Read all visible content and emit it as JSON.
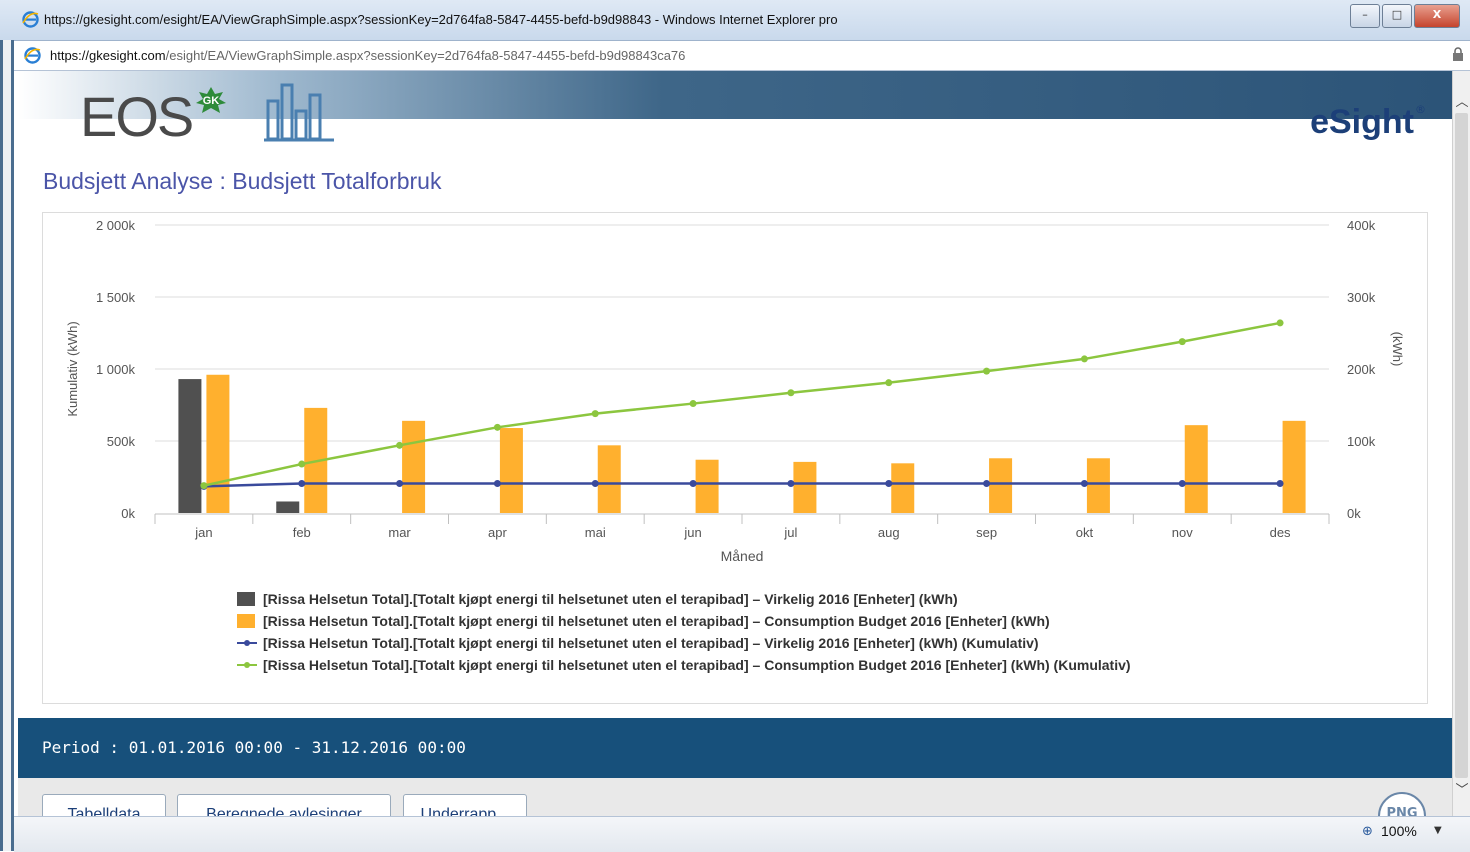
{
  "window": {
    "title": "https://gkesight.com/esight/EA/ViewGraphSimple.aspx?sessionKey=2d764fa8-5847-4455-befd-b9d98843 - Windows Internet Explorer pro",
    "minimize_label": "–",
    "maximize_label": "□",
    "close_label": "X"
  },
  "address": {
    "host": "https://gkesight.com",
    "path": "/esight/EA/ViewGraphSimple.aspx?sessionKey=2d764fa8-5847-4455-befd-b9d98843ca76"
  },
  "brand": {
    "logo_text": "EOS",
    "badge_text": "GK",
    "product_name": "eSight",
    "registered": "®"
  },
  "page_title": "Budsjett Analyse : Budsjett Totalforbruk",
  "chart_data": {
    "type": "bar",
    "xlabel": "Måned",
    "ylabel_left": "Kumulativ (kWh)",
    "ylabel_right": "(kWh)",
    "categories": [
      "jan",
      "feb",
      "mar",
      "apr",
      "mai",
      "jun",
      "jul",
      "aug",
      "sep",
      "okt",
      "nov",
      "des"
    ],
    "y_left_lim": [
      0,
      2000000
    ],
    "y_right_lim": [
      0,
      400000
    ],
    "y_left_ticks": [
      {
        "value": 0,
        "label": "0k"
      },
      {
        "value": 500000,
        "label": "500k"
      },
      {
        "value": 1000000,
        "label": "1 000k"
      },
      {
        "value": 1500000,
        "label": "1 500k"
      },
      {
        "value": 2000000,
        "label": "2 000k"
      }
    ],
    "y_right_ticks": [
      {
        "value": 0,
        "label": "0k"
      },
      {
        "value": 100000,
        "label": "100k"
      },
      {
        "value": 200000,
        "label": "200k"
      },
      {
        "value": 300000,
        "label": "300k"
      },
      {
        "value": 400000,
        "label": "400k"
      }
    ],
    "grid": true,
    "legend_position": "bottom",
    "series": [
      {
        "name": "[Rissa Helsetun Total].[Totalt kjøpt energi til helsetunet uten el terapibad] – Virkelig 2016 [Enheter] (kWh)",
        "kind": "bar",
        "axis": "left",
        "color": "#505050",
        "values": [
          930000,
          80000,
          null,
          null,
          null,
          null,
          null,
          null,
          null,
          null,
          null,
          null
        ]
      },
      {
        "name": "[Rissa Helsetun Total].[Totalt kjøpt energi til helsetunet uten el terapibad] – Consumption Budget 2016 [Enheter] (kWh)",
        "kind": "bar",
        "axis": "left",
        "color": "#ffb02e",
        "values": [
          960000,
          730000,
          640000,
          590000,
          470000,
          370000,
          355000,
          345000,
          380000,
          380000,
          610000,
          640000
        ]
      },
      {
        "name": "[Rissa Helsetun Total].[Totalt kjøpt energi til helsetunet uten el terapibad] – Virkelig 2016 [Enheter] (kWh) (Kumulativ)",
        "kind": "line",
        "axis": "right",
        "color": "#3a4a9c",
        "values": [
          37000,
          41000,
          41000,
          41000,
          41000,
          41000,
          41000,
          41000,
          41000,
          41000,
          41000,
          41000
        ]
      },
      {
        "name": "[Rissa Helsetun Total].[Totalt kjøpt energi til helsetunet uten el terapibad] – Consumption Budget 2016 [Enheter] (kWh) (Kumulativ)",
        "kind": "line",
        "axis": "right",
        "color": "#8cc63f",
        "values": [
          38000,
          68000,
          94000,
          119000,
          138000,
          152000,
          167000,
          181000,
          197000,
          214000,
          238000,
          264000
        ]
      }
    ]
  },
  "period_text": "Period : 01.01.2016 00:00 - 31.12.2016 00:00",
  "tabs": {
    "tabelldata": "Tabelldata",
    "beregnede": "Beregnede avlesinger",
    "underrapport": "Underrapp..."
  },
  "png_label": "PNG",
  "status": {
    "zoom": "100%"
  }
}
